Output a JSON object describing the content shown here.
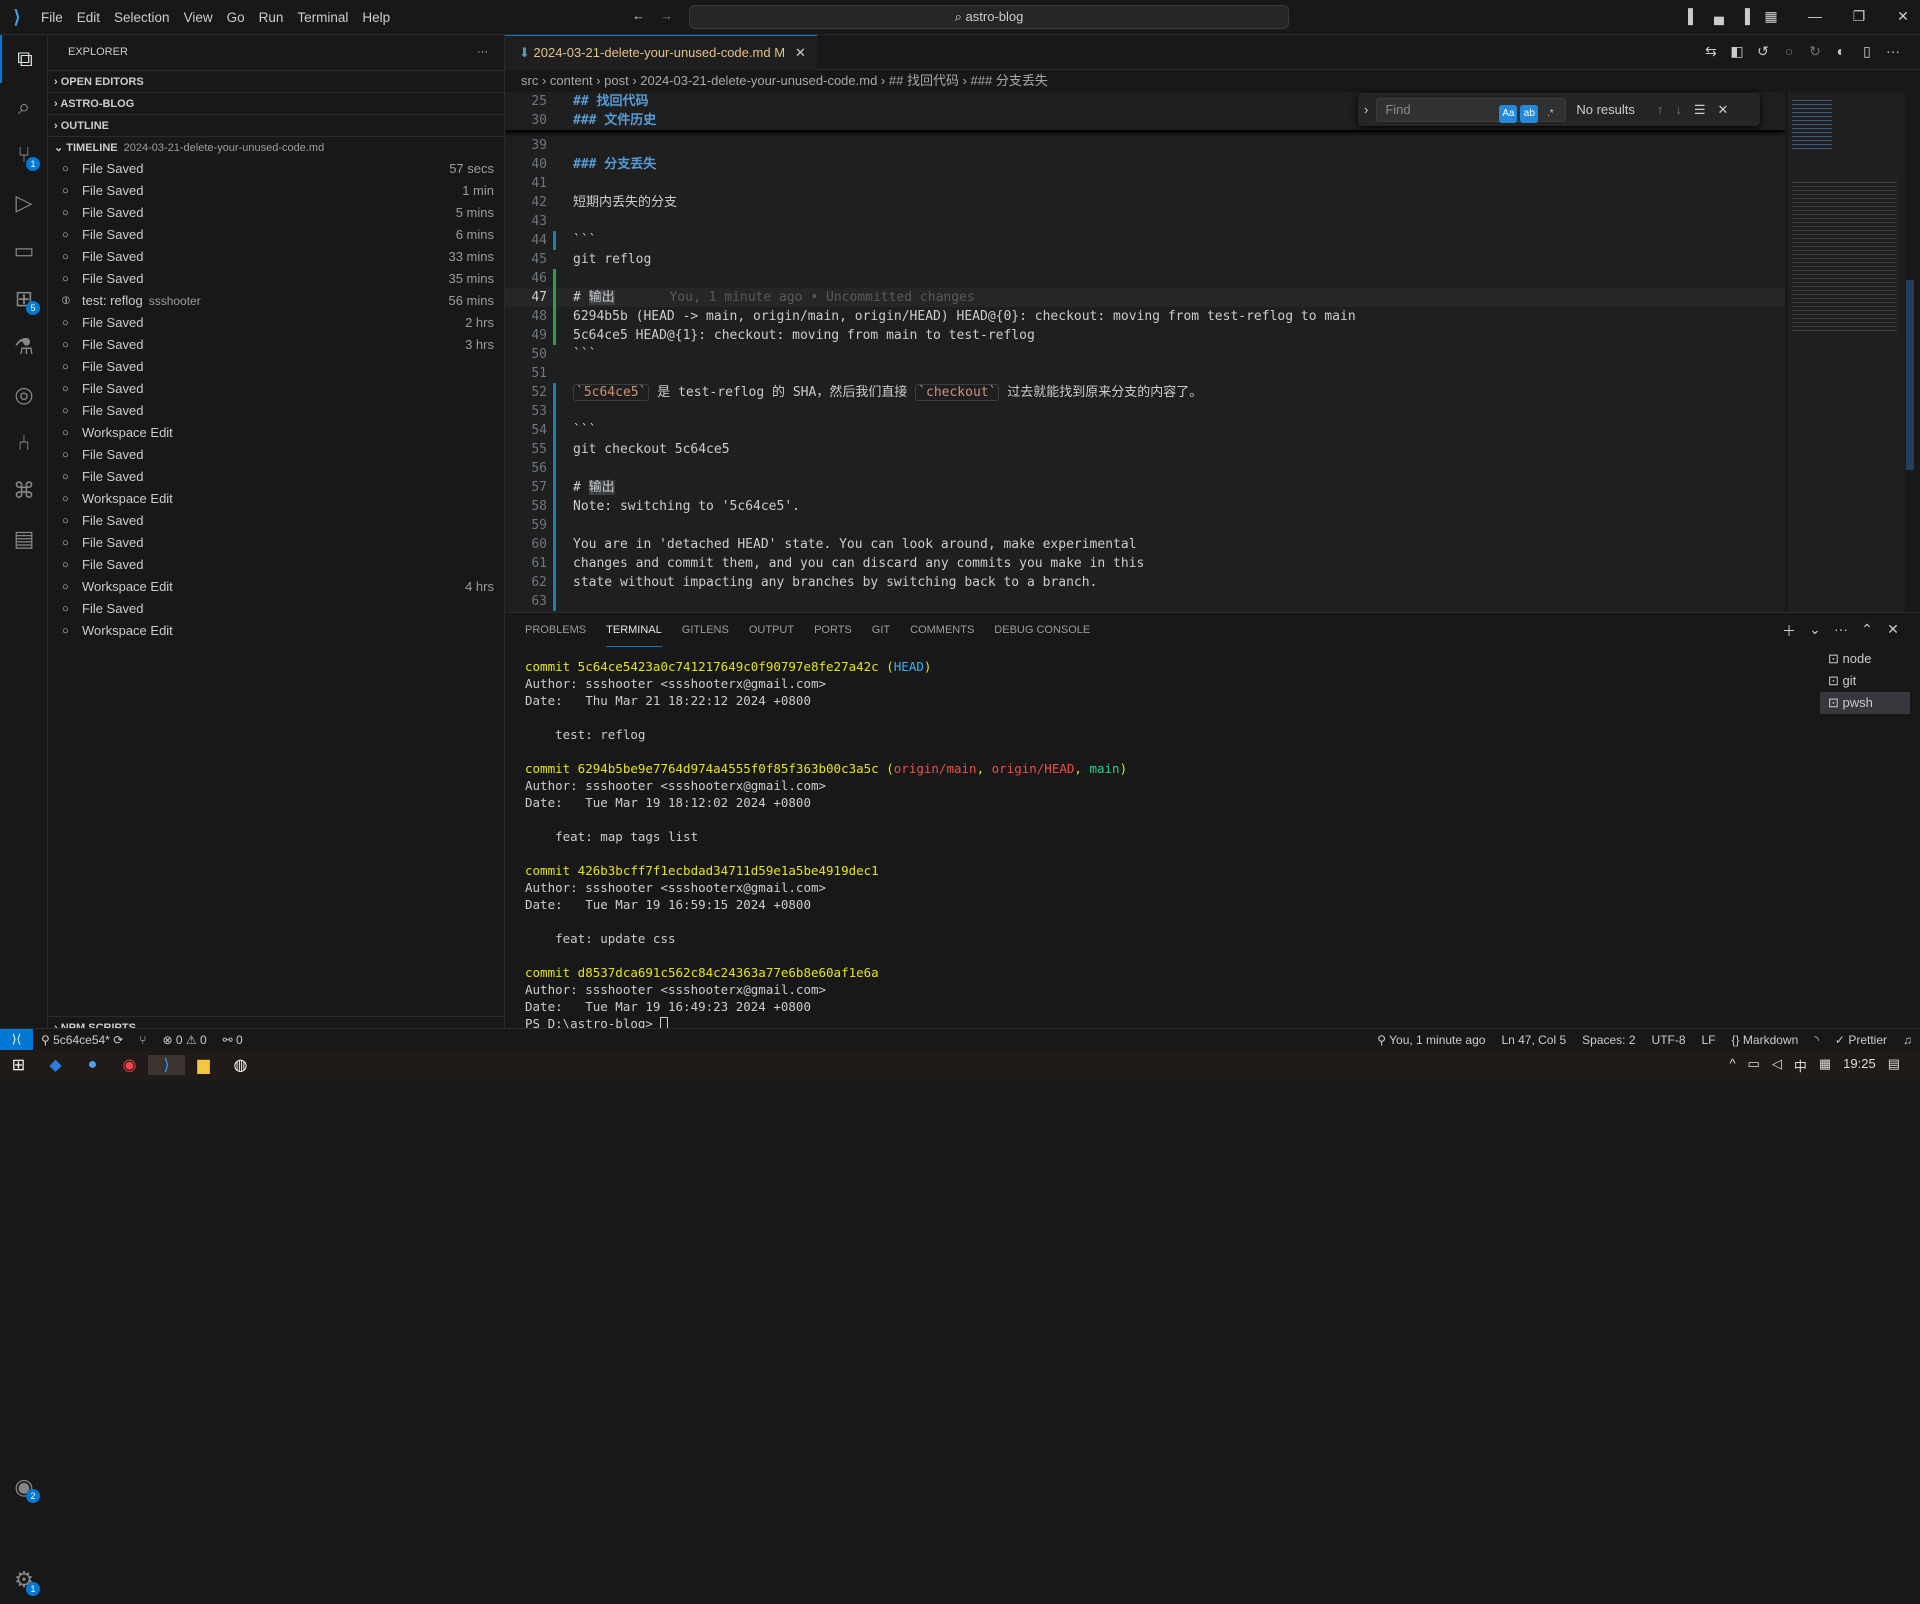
{
  "titlebar": {
    "menu": [
      "File",
      "Edit",
      "Selection",
      "View",
      "Go",
      "Run",
      "Terminal",
      "Help"
    ],
    "search": "astro-blog",
    "search_icon": "search-icon"
  },
  "activity": {
    "items": [
      {
        "name": "explorer",
        "icon": "⧉"
      },
      {
        "name": "search",
        "icon": "⌕"
      },
      {
        "name": "source-control",
        "icon": "⑂",
        "badge": "1"
      },
      {
        "name": "run-debug",
        "icon": "▷"
      },
      {
        "name": "remote-explorer",
        "icon": "▭"
      },
      {
        "name": "extensions",
        "icon": "⊞",
        "badge": "5"
      },
      {
        "name": "testing",
        "icon": "⚗"
      },
      {
        "name": "gitlens",
        "icon": "◎"
      },
      {
        "name": "git-graph",
        "icon": "⑃"
      },
      {
        "name": "source-graph",
        "icon": "⌘"
      },
      {
        "name": "comments",
        "icon": "▤"
      }
    ],
    "account_badge": "2",
    "settings_badge": "1"
  },
  "sidebar": {
    "title": "EXPLORER",
    "sections": [
      "OPEN EDITORS",
      "ASTRO-BLOG",
      "OUTLINE"
    ],
    "timeline_title": "TIMELINE",
    "timeline_file": "2024-03-21-delete-your-unused-code.md",
    "npm": "NPM SCRIPTS",
    "timeline": [
      {
        "label": "File Saved",
        "time": "57 secs"
      },
      {
        "label": "File Saved",
        "time": "1 min"
      },
      {
        "label": "File Saved",
        "time": "5 mins"
      },
      {
        "label": "File Saved",
        "time": "6 mins"
      },
      {
        "label": "File Saved",
        "time": "33 mins"
      },
      {
        "label": "File Saved",
        "time": "35 mins"
      },
      {
        "label": "test: reflog",
        "author": "ssshooter",
        "time": "56 mins",
        "commit": true
      },
      {
        "label": "File Saved",
        "time": "2 hrs"
      },
      {
        "label": "File Saved",
        "time": "3 hrs"
      },
      {
        "label": "File Saved"
      },
      {
        "label": "File Saved"
      },
      {
        "label": "File Saved"
      },
      {
        "label": "Workspace Edit"
      },
      {
        "label": "File Saved"
      },
      {
        "label": "File Saved"
      },
      {
        "label": "Workspace Edit"
      },
      {
        "label": "File Saved"
      },
      {
        "label": "File Saved"
      },
      {
        "label": "File Saved"
      },
      {
        "label": "Workspace Edit",
        "time": "4 hrs"
      },
      {
        "label": "File Saved"
      },
      {
        "label": "Workspace Edit"
      }
    ]
  },
  "editor": {
    "tab": "2024-03-21-delete-your-unused-code.md",
    "tab_status": "M",
    "breadcrumbs": [
      "src",
      "content",
      "post",
      "2024-03-21-delete-your-unused-code.md",
      "## 找回代码",
      "### 分支丢失"
    ],
    "sticky": [
      {
        "n": "25",
        "segs": [
          {
            "t": "## 找回代码",
            "c": "h"
          }
        ]
      },
      {
        "n": "30",
        "segs": [
          {
            "t": "### 文件历史",
            "c": "h"
          }
        ]
      }
    ],
    "lines": [
      {
        "n": "39",
        "segs": []
      },
      {
        "n": "40",
        "segs": [
          {
            "t": "### 分支丢失",
            "c": "h"
          }
        ]
      },
      {
        "n": "41",
        "segs": []
      },
      {
        "n": "42",
        "segs": [
          {
            "t": "短期内丢失的分支"
          }
        ]
      },
      {
        "n": "43",
        "segs": []
      },
      {
        "n": "44",
        "segs": [
          {
            "t": "```"
          }
        ]
      },
      {
        "n": "45",
        "segs": [
          {
            "t": "git reflog"
          }
        ]
      },
      {
        "n": "46",
        "segs": []
      },
      {
        "n": "47",
        "segs": [
          {
            "t": "# "
          },
          {
            "t": "输出",
            "c": "hl"
          },
          {
            "t": "       You, 1 minute ago • Uncommitted changes",
            "c": "ghost"
          }
        ]
      },
      {
        "n": "48",
        "segs": [
          {
            "t": "6294b5b (HEAD -> main, origin/main, origin/HEAD) HEAD@{0}: checkout: moving from test-reflog to main"
          }
        ]
      },
      {
        "n": "49",
        "segs": [
          {
            "t": "5c64ce5 HEAD@{1}: checkout: moving from main to test-reflog"
          }
        ]
      },
      {
        "n": "50",
        "segs": [
          {
            "t": "```"
          }
        ]
      },
      {
        "n": "51",
        "segs": []
      },
      {
        "n": "52",
        "segs": [
          {
            "t": "`5c64ce5`",
            "c": "ic"
          },
          {
            "t": " 是 test-reflog 的 SHA，然后我们直接 "
          },
          {
            "t": "`checkout`",
            "c": "ic"
          },
          {
            "t": " 过去就能找到原来分支的内容了。"
          }
        ]
      },
      {
        "n": "53",
        "segs": []
      },
      {
        "n": "54",
        "segs": [
          {
            "t": "```"
          }
        ]
      },
      {
        "n": "55",
        "segs": [
          {
            "t": "git checkout 5c64ce5"
          }
        ]
      },
      {
        "n": "56",
        "segs": []
      },
      {
        "n": "57",
        "segs": [
          {
            "t": "# "
          },
          {
            "t": "输出",
            "c": "hl"
          }
        ]
      },
      {
        "n": "58",
        "segs": [
          {
            "t": "Note: switching to '5c64ce5'."
          }
        ]
      },
      {
        "n": "59",
        "segs": []
      },
      {
        "n": "60",
        "segs": [
          {
            "t": "You are in 'detached HEAD' state. You can look around, make experimental"
          }
        ]
      },
      {
        "n": "61",
        "segs": [
          {
            "t": "changes and commit them, and you can discard any commits you make in this"
          }
        ]
      },
      {
        "n": "62",
        "segs": [
          {
            "t": "state without impacting any branches by switching back to a branch."
          }
        ]
      },
      {
        "n": "63",
        "segs": []
      }
    ],
    "current_line": "47"
  },
  "find": {
    "placeholder": "Find",
    "case": "Aa",
    "word": "ab",
    "regex": ".*",
    "result": "No results"
  },
  "panel": {
    "tabs": [
      "PROBLEMS",
      "TERMINAL",
      "GITLENS",
      "OUTPUT",
      "PORTS",
      "GIT",
      "COMMENTS",
      "DEBUG CONSOLE"
    ],
    "active": "TERMINAL",
    "terminals": [
      "node",
      "git",
      "pwsh"
    ],
    "active_terminal": "pwsh",
    "lines": [
      [
        {
          "t": "commit 5c64ce5423a0c741217649c0f90797e8fe27a42c (",
          "c": "y"
        },
        {
          "t": "HEAD",
          "c": "b"
        },
        {
          "t": ")",
          "c": "y"
        }
      ],
      [
        {
          "t": "Author: ssshooter <ssshooterx@gmail.com>"
        }
      ],
      [
        {
          "t": "Date:   Thu Mar 21 18:22:12 2024 +0800"
        }
      ],
      [],
      [
        {
          "t": "    test: reflog"
        }
      ],
      [],
      [
        {
          "t": "commit 6294b5be9e7764d974a4555f0f85f363b00c3a5c (",
          "c": "y"
        },
        {
          "t": "origin/main",
          "c": "r"
        },
        {
          "t": ", ",
          "c": "y"
        },
        {
          "t": "origin/HEAD",
          "c": "r"
        },
        {
          "t": ", ",
          "c": "y"
        },
        {
          "t": "main",
          "c": "g"
        },
        {
          "t": ")",
          "c": "y"
        }
      ],
      [
        {
          "t": "Author: ssshooter <ssshooterx@gmail.com>"
        }
      ],
      [
        {
          "t": "Date:   Tue Mar 19 18:12:02 2024 +0800"
        }
      ],
      [],
      [
        {
          "t": "    feat: map tags list"
        }
      ],
      [],
      [
        {
          "t": "commit 426b3bcff7f1ecbdad34711d59e1a5be4919dec1",
          "c": "y"
        }
      ],
      [
        {
          "t": "Author: ssshooter <ssshooterx@gmail.com>"
        }
      ],
      [
        {
          "t": "Date:   Tue Mar 19 16:59:15 2024 +0800"
        }
      ],
      [],
      [
        {
          "t": "    feat: update css"
        }
      ],
      [],
      [
        {
          "t": "commit d8537dca691c562c84c24363a77e6b8e60af1e6a",
          "c": "y"
        }
      ],
      [
        {
          "t": "Author: ssshooter <ssshooterx@gmail.com>"
        }
      ],
      [
        {
          "t": "Date:   Tue Mar 19 16:49:23 2024 +0800"
        }
      ],
      [
        {
          "t": "PS D:\\astro-blog> "
        }
      ]
    ]
  },
  "status": {
    "branch": "5c64ce54*",
    "errors": "0",
    "warnings": "0",
    "ports": "0",
    "blame": "You, 1 minute ago",
    "position": "Ln 47, Col 5",
    "spaces": "Spaces: 2",
    "encoding": "UTF-8",
    "eol": "LF",
    "language": "Markdown",
    "formatter": "Prettier"
  },
  "taskbar": {
    "clock": "19:25",
    "ime": "中"
  },
  "colors": {
    "accent": "#0078d4",
    "heading": "#569cd6",
    "yellow": "#e5e510"
  }
}
